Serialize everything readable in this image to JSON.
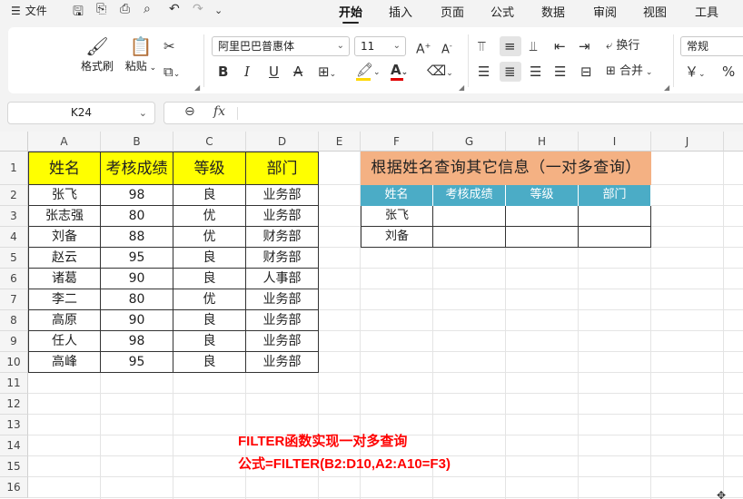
{
  "menu": {
    "menu_icon": "hamburger-icon",
    "file_label": "文件",
    "tabs": [
      "开始",
      "插入",
      "页面",
      "公式",
      "数据",
      "审阅",
      "视图",
      "工具"
    ],
    "active_tab": "开始"
  },
  "ribbon": {
    "format_painter": "格式刷",
    "paste": "粘贴",
    "font_name": "阿里巴巴普惠体",
    "font_size": "11",
    "wrap_text": "换行",
    "merge": "合并",
    "number_format": "常规",
    "currency": "￥",
    "percent": "%",
    "font_color": "#e00000",
    "fill_color": "#ffd700"
  },
  "formula_bar": {
    "name_box": "K24",
    "fx": "fx",
    "formula": ""
  },
  "sheet": {
    "columns": [
      "A",
      "B",
      "C",
      "D",
      "E",
      "F",
      "G",
      "H",
      "I",
      "J"
    ],
    "rows": [
      "1",
      "2",
      "3",
      "4",
      "5",
      "6",
      "7",
      "8",
      "9",
      "10",
      "11",
      "12",
      "13",
      "14",
      "15",
      "16"
    ],
    "source_headers": [
      "姓名",
      "考核成绩",
      "等级",
      "部门"
    ],
    "source_rows": [
      [
        "张飞",
        "98",
        "良",
        "业务部"
      ],
      [
        "张志强",
        "80",
        "优",
        "业务部"
      ],
      [
        "刘备",
        "88",
        "优",
        "财务部"
      ],
      [
        "赵云",
        "95",
        "良",
        "财务部"
      ],
      [
        "诸葛",
        "90",
        "良",
        "人事部"
      ],
      [
        "李二",
        "80",
        "优",
        "业务部"
      ],
      [
        "高原",
        "90",
        "良",
        "业务部"
      ],
      [
        "任人",
        "98",
        "良",
        "业务部"
      ],
      [
        "高峰",
        "95",
        "良",
        "业务部"
      ]
    ],
    "query_title": "根据姓名查询其它信息（一对多查询）",
    "query_headers": [
      "姓名",
      "考核成绩",
      "等级",
      "部门"
    ],
    "query_rows": [
      [
        "张飞",
        "",
        "",
        ""
      ],
      [
        "刘备",
        "",
        "",
        ""
      ]
    ],
    "annotation_line1": "FILTER函数实现一对多查询",
    "annotation_line2": "公式=FILTER(B2:D10,A2:A10=F3)"
  },
  "colors": {
    "header_yellow": "#ffff00",
    "title_orange": "#f4b183",
    "query_header_teal": "#4bacc6",
    "annotation_red": "#ff0000"
  }
}
